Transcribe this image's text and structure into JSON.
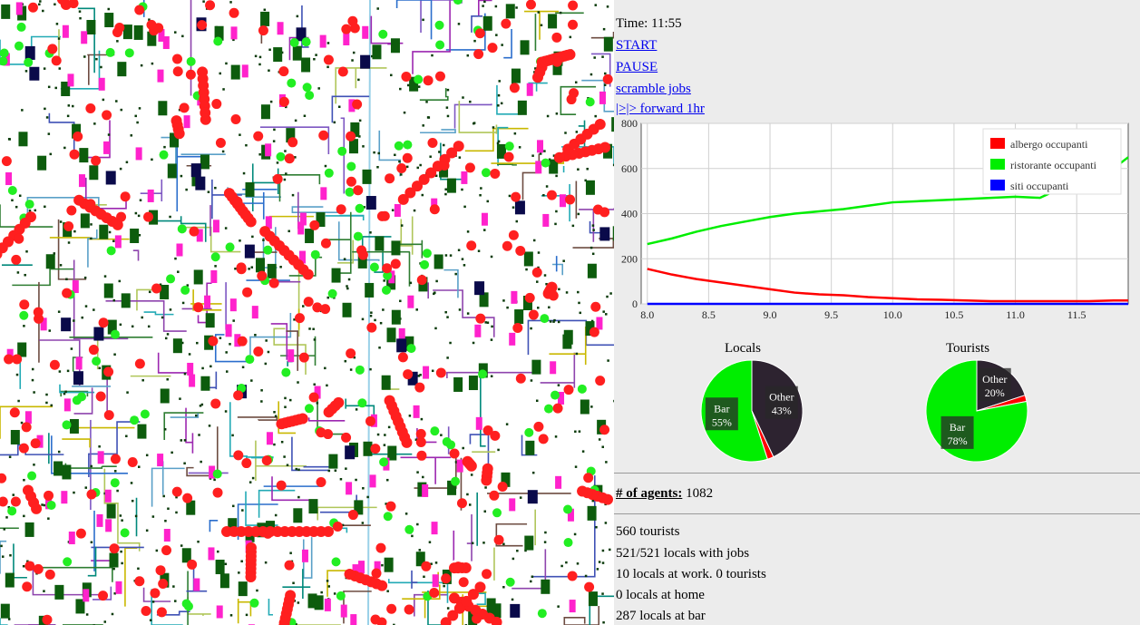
{
  "controls": {
    "time_label": "Time: 11:55",
    "start": "START",
    "pause": "PAUSE",
    "scramble": "scramble jobs",
    "forward": "|>|> forward 1hr"
  },
  "chart_data": {
    "type": "line",
    "x": [
      8.0,
      8.2,
      8.4,
      8.6,
      8.8,
      9.0,
      9.2,
      9.4,
      9.6,
      9.8,
      10.0,
      10.2,
      10.4,
      10.6,
      10.8,
      11.0,
      11.2,
      11.4,
      11.6,
      11.8,
      11.92
    ],
    "series": [
      {
        "name": "albergo occupanti",
        "color": "#ff0000",
        "values": [
          155,
          130,
          110,
          95,
          80,
          65,
          50,
          42,
          38,
          30,
          25,
          20,
          18,
          15,
          12,
          12,
          12,
          12,
          12,
          15,
          15
        ]
      },
      {
        "name": "ristorante occupanti",
        "color": "#00ee00",
        "values": [
          265,
          290,
          320,
          345,
          365,
          385,
          400,
          410,
          420,
          435,
          450,
          455,
          460,
          465,
          470,
          475,
          470,
          520,
          560,
          600,
          650
        ]
      },
      {
        "name": "siti occupanti",
        "color": "#0000ff",
        "values": [
          0,
          0,
          0,
          0,
          0,
          0,
          0,
          0,
          0,
          0,
          0,
          0,
          0,
          0,
          0,
          0,
          0,
          0,
          0,
          0,
          0
        ]
      }
    ],
    "xlim": [
      7.95,
      11.92
    ],
    "ylim": [
      0,
      800
    ],
    "x_ticks": [
      "8.0",
      "8.5",
      "9.0",
      "9.5",
      "10.0",
      "10.5",
      "11.0",
      "11.5"
    ],
    "y_ticks": [
      "0",
      "200",
      "400",
      "600",
      "800"
    ],
    "grid": true,
    "legend_position": "top-right"
  },
  "pies": [
    {
      "title": "Locals",
      "slices": [
        {
          "label": "Other",
          "value": 43,
          "color": "#2d2330"
        },
        {
          "label": "",
          "value": 2,
          "color": "#ff0000"
        },
        {
          "label": "Bar",
          "value": 55,
          "color": "#00ee00"
        }
      ]
    },
    {
      "title": "Tourists",
      "slices": [
        {
          "label": "Other",
          "value": 20,
          "color": "#2d2330"
        },
        {
          "label": "",
          "value": 2,
          "color": "#ff0000"
        },
        {
          "label": "Bar",
          "value": 78,
          "color": "#00ee00"
        }
      ]
    }
  ],
  "stats": {
    "agents_label": "# of agents:",
    "agents_value": " 1082",
    "tourists": "560 tourists",
    "locals_jobs": "521/521 locals with jobs",
    "at_work": "10 locals at work. 0 tourists",
    "at_home": "0 locals at home",
    "at_bar": "287 locals at bar"
  },
  "map_colors": {
    "agent": "#ff1f1f",
    "agent_moving": "#22ee22",
    "building_work": "#0d5c0d",
    "building_hotel": "#ff22cc",
    "building_site": "#0a0a4a"
  }
}
